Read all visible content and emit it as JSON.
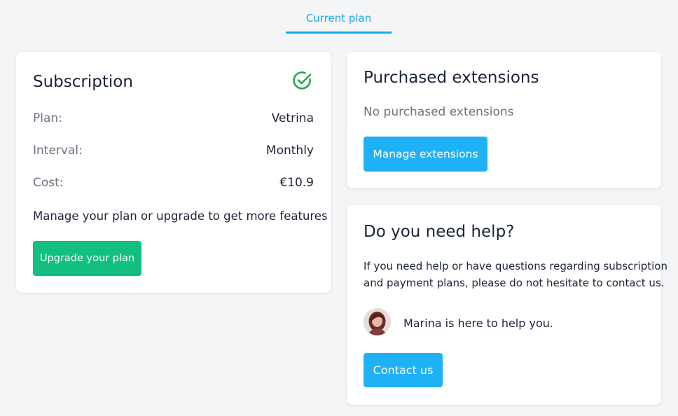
{
  "tabs": {
    "current_plan": "Current plan"
  },
  "subscription": {
    "title": "Subscription",
    "status_icon": "check-circle-icon",
    "rows": [
      {
        "label": "Plan:",
        "value": "Vetrina"
      },
      {
        "label": "Interval:",
        "value": "Monthly"
      },
      {
        "label": "Cost:",
        "value": "€10.9"
      }
    ],
    "description": "Manage your plan or upgrade to get more features",
    "upgrade_button": "Upgrade your plan"
  },
  "extensions": {
    "title": "Purchased extensions",
    "empty_text": "No purchased extensions",
    "manage_button": "Manage extensions"
  },
  "help": {
    "title": "Do you need help?",
    "description_line1": "If you need help or have questions regarding subscription",
    "description_line2": "and payment plans, please do not hesitate to contact us.",
    "agent_text": "Marina is here to help you.",
    "contact_button": "Contact us"
  },
  "colors": {
    "accent_blue": "#1aa9f0",
    "button_blue": "#1fb1f6",
    "button_green": "#12bf7f",
    "check_green": "#1fa94f"
  }
}
